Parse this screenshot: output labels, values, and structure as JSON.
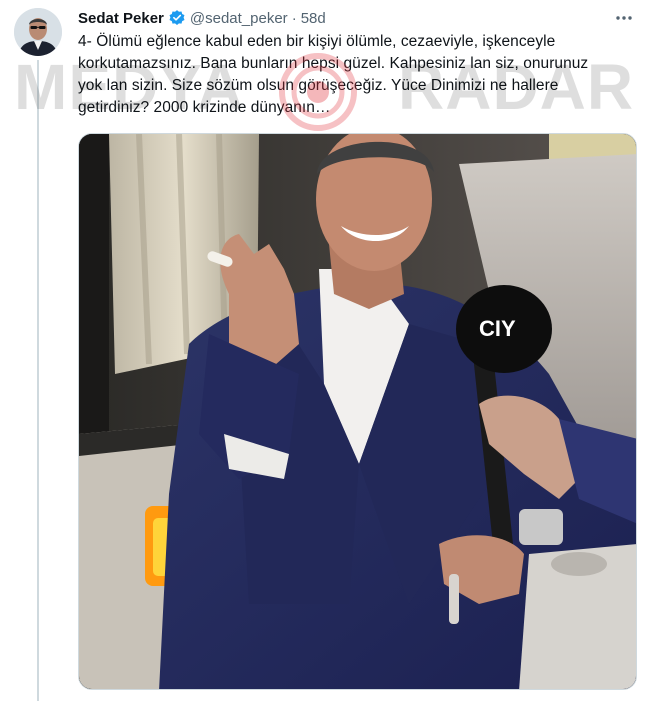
{
  "tweet": {
    "author": {
      "display_name": "Sedat Peker",
      "handle": "@sedat_peker",
      "verified": true
    },
    "separator": "·",
    "timestamp": "58d",
    "more_icon": "more-horizontal-icon",
    "text_lines": [
      "4- Ölümü eğlence kabul eden bir kişiyi ölümle, cezaeviyle, işkenceyle",
      "korkutamazsınız. Bana bunların hepsi güzel. Kahpesiniz lan siz, onurunuz",
      "yok lan sizin. Size sözüm olsun görüşeceğiz. Yüce Dinimizi ne hallere",
      "getirdiniz? 2000 krizinde dünyanın…"
    ],
    "media": {
      "type": "video-thumbnail",
      "microphone_logo": "CIY"
    }
  },
  "watermark": {
    "left_word": "MEDYA",
    "right_word": "RADAR"
  },
  "colors": {
    "verified_blue": "#1d9bf0",
    "text_primary": "#0f1419",
    "text_secondary": "#536471",
    "thread_line": "#cfd9de",
    "watermark_red": "#e0323a"
  }
}
